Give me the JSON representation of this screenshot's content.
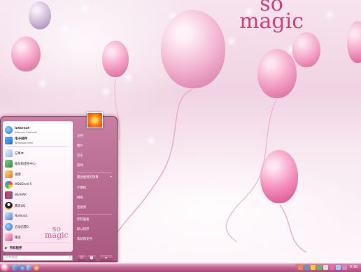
{
  "wallpaper": {
    "logo_line1": "so",
    "logo_line2": "magic"
  },
  "start_menu": {
    "pinned": [
      {
        "title": "Internet",
        "subtitle": "Internet Explorer",
        "icon": "internet-explorer-icon"
      },
      {
        "title": "电子邮件",
        "subtitle": "Windows Mail",
        "icon": "mail-icon"
      }
    ],
    "recent": [
      {
        "label": "记事本",
        "icon": "notepad-icon"
      },
      {
        "label": "备份和还原中心",
        "icon": "backup-icon"
      },
      {
        "label": "画图",
        "icon": "paint-icon"
      },
      {
        "label": "MSNShell 5",
        "icon": "msn-shell-icon"
      },
      {
        "label": "WinRAR",
        "icon": "winrar-icon"
      },
      {
        "label": "腾讯QQ",
        "icon": "qq-icon"
      },
      {
        "label": "Notepad",
        "icon": "notepad2-icon"
      },
      {
        "label": "启动迅雷5",
        "icon": "thunder-icon"
      },
      {
        "label": "墨迹",
        "icon": "ink-icon"
      }
    ],
    "all_programs": "所有程序",
    "logo_line1": "so",
    "logo_line2": "magic",
    "search_placeholder": "开始搜索",
    "right": [
      {
        "label": "文档"
      },
      {
        "label": "图片"
      },
      {
        "label": "音乐"
      },
      {
        "label": "游戏"
      },
      {
        "label": "最近使用的项目"
      },
      {
        "label": "计算机"
      },
      {
        "label": "网络"
      },
      {
        "label": "连接到"
      },
      {
        "label": "控制面板"
      },
      {
        "label": "默认程序"
      },
      {
        "label": "帮助和支持"
      }
    ]
  },
  "taskbar": {
    "clock": "9:38"
  },
  "colors": {
    "accent": "#c0477f",
    "taskbar": "#a44874"
  }
}
